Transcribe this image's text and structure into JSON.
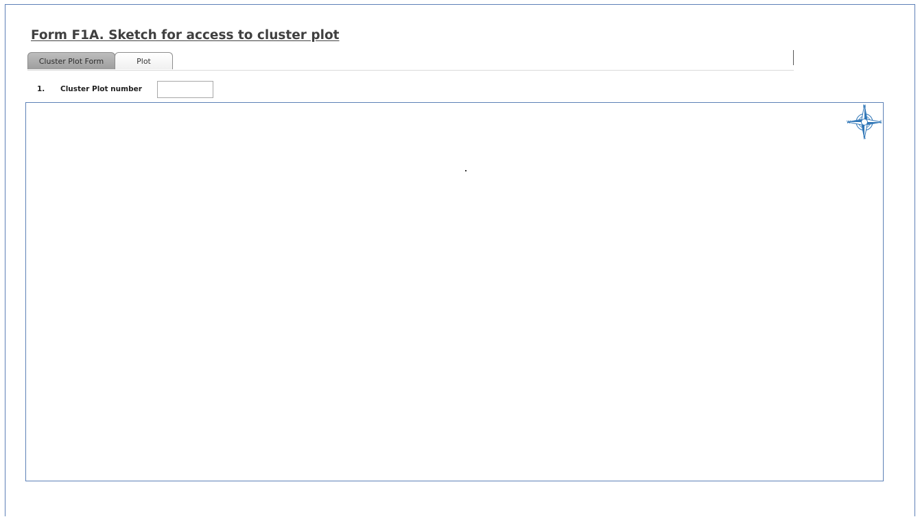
{
  "form": {
    "title": "Form F1A. Sketch for access to cluster plot"
  },
  "tabs": [
    {
      "label": "Cluster Plot Form",
      "active": true
    },
    {
      "label": "Plot",
      "active": false
    }
  ],
  "fields": [
    {
      "number": "1.",
      "label": "Cluster Plot number",
      "value": "",
      "placeholder": ""
    }
  ],
  "compass": {
    "icon": "compass-rose-icon",
    "north": "N",
    "south": "S",
    "east": "E",
    "west": "W",
    "color": "#2e75b6"
  },
  "colors": {
    "border": "#5b7fb6",
    "title": "#404040",
    "active_tab": "#a6a6a6"
  }
}
